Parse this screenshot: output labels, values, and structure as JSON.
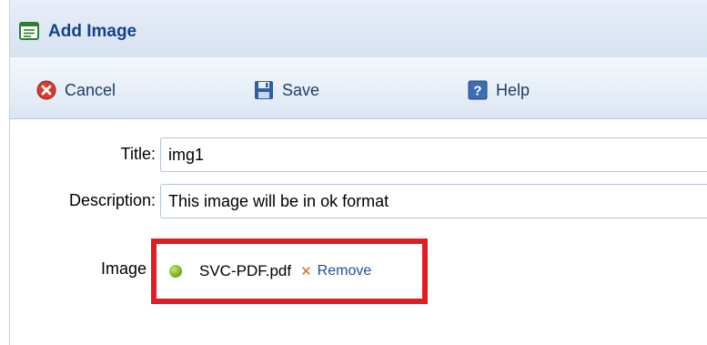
{
  "window": {
    "title": "Add Image",
    "icon": "form-window-icon"
  },
  "toolbar": {
    "cancel_label": "Cancel",
    "save_label": "Save",
    "help_label": "Help"
  },
  "form": {
    "title_label": "Title:",
    "title_value": "img1",
    "description_label": "Description:",
    "description_value": "This image will be in ok format",
    "image_label": "Image",
    "file_name": "SVC-PDF.pdf",
    "remove_label": "Remove"
  },
  "colors": {
    "highlight_border": "#e31b23",
    "title_text": "#15428b",
    "status_dot": "#7ab31f",
    "remove_x": "#e8641b"
  }
}
